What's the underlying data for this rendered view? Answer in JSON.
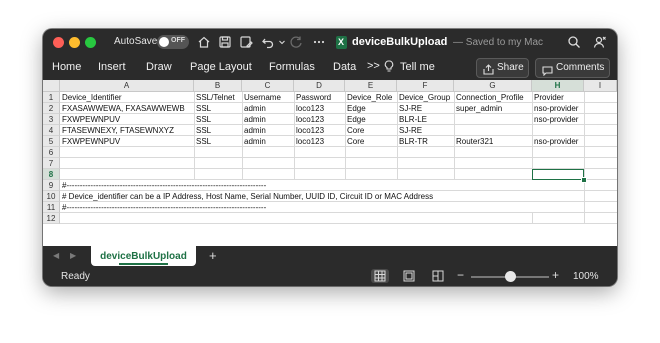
{
  "titlebar": {
    "autosave_label": "AutoSave",
    "toggle_text": "OFF",
    "doc_title": "deviceBulkUpload",
    "doc_status": "— Saved to my Mac",
    "doc_icon_letter": "X"
  },
  "ribbon": {
    "tabs": [
      "Home",
      "Insert",
      "Draw",
      "Page Layout",
      "Formulas",
      "Data"
    ],
    "more": ">>",
    "tell_me": "Tell me",
    "share_label": "Share",
    "comments_label": "Comments"
  },
  "sheet": {
    "columns": [
      "A",
      "B",
      "C",
      "D",
      "E",
      "F",
      "G",
      "H",
      "I"
    ],
    "selected_column": "H",
    "selected_row": "8",
    "rows": [
      "1",
      "2",
      "3",
      "4",
      "5",
      "6",
      "7",
      "8",
      "9",
      "10",
      "11",
      "12"
    ],
    "cells": {
      "r1": [
        "Device_Identifier",
        "SSL/Telnet",
        "Username",
        "Password",
        "Device_Role",
        "Device_Group",
        "Connection_Profile",
        "Provider"
      ],
      "r2": [
        "FXASAWWEWA, FXASAWWEWB",
        "SSL",
        "admin",
        "loco123",
        "Edge",
        "SJ-RE",
        "super_admin",
        "nso-provider"
      ],
      "r3": [
        "FXWPEWNPUV",
        "SSL",
        "admin",
        "loco123",
        "Edge",
        "BLR-LE",
        "",
        "nso-provider"
      ],
      "r4": [
        "FTASEWNEXY, FTASEWNXYZ",
        "SSL",
        "admin",
        "loco123",
        "Core",
        "SJ-RE",
        "",
        ""
      ],
      "r5": [
        "FXWPEWNPUV",
        "SSL",
        "admin",
        "loco123",
        "Core",
        "BLR-TR",
        "Router321",
        "nso-provider"
      ],
      "r9": "#---------------------------------------------------------------------------",
      "r10": "# Device_identifier can be a IP Address, Host Name, Serial Number, UUID ID, Circuit ID or MAC Address",
      "r11": "#---------------------------------------------------------------------------"
    }
  },
  "tabs": {
    "sheet_name": "deviceBulkUpload",
    "add": "+",
    "prev": "◀",
    "next": "▶"
  },
  "status": {
    "ready": "Ready",
    "zoom_minus": "−",
    "zoom_plus": "+",
    "zoom_level": "100%",
    "zoom_fraction": 0.5
  }
}
